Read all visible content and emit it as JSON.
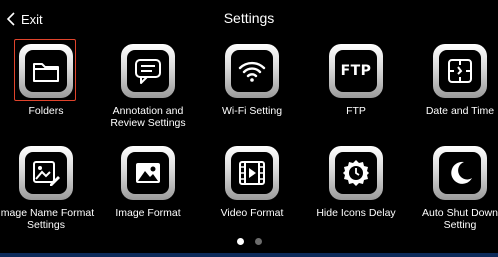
{
  "header": {
    "back_label": "Exit",
    "title": "Settings"
  },
  "tiles": [
    {
      "label": "Folders",
      "icon": "folder-icon"
    },
    {
      "label": "Annotation and\nReview Settings",
      "icon": "message-icon"
    },
    {
      "label": "Wi-Fi Setting",
      "icon": "wifi-icon"
    },
    {
      "label": "FTP",
      "icon": "ftp-icon",
      "icon_text": "FTP"
    },
    {
      "label": "Date and Time",
      "icon": "clock-icon"
    },
    {
      "label": "Image Name Format\nSettings",
      "icon": "image-edit-icon"
    },
    {
      "label": "Image Format",
      "icon": "image-icon"
    },
    {
      "label": "Video Format",
      "icon": "video-icon"
    },
    {
      "label": "Hide Icons Delay",
      "icon": "timer-icon"
    },
    {
      "label": "Auto Shut Down\nSetting",
      "icon": "moon-icon"
    }
  ],
  "pagination": {
    "pages": 2,
    "current": 1
  },
  "colors": {
    "selection": "#e0442c",
    "background": "#000000"
  }
}
